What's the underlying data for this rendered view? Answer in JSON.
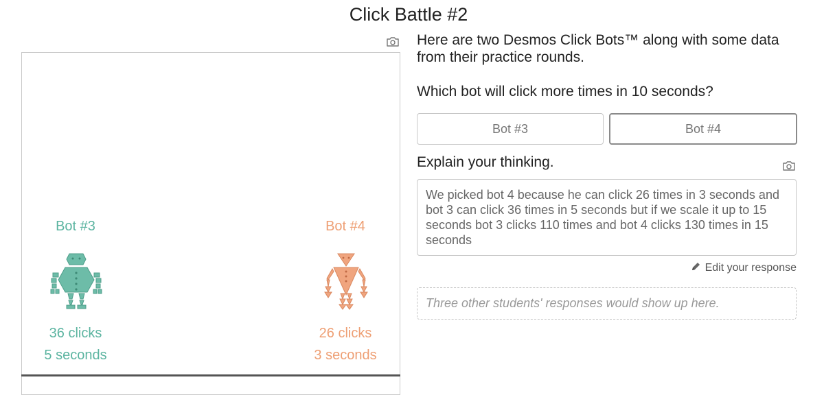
{
  "header": {
    "title": "Click Battle #2"
  },
  "icons": {
    "snapshot": "camera-icon",
    "edit": "pencil-icon"
  },
  "graph": {
    "bots": [
      {
        "name": "Bot #3",
        "clicks": "36 clicks",
        "time": "5 seconds",
        "color": "#5bb4a0"
      },
      {
        "name": "Bot #4",
        "clicks": "26 clicks",
        "time": "3 seconds",
        "color": "#ee9f74"
      }
    ]
  },
  "content": {
    "prompt": "Here are two Desmos Click Bots™ along with some data from their practice rounds.",
    "question": "Which bot will click more times in 10 seconds?",
    "choices": [
      {
        "label": "Bot #3",
        "selected": false
      },
      {
        "label": "Bot #4",
        "selected": true
      }
    ],
    "explain_label": "Explain your thinking.",
    "response_text": "We picked bot 4 because he can click 26 times in 3 seconds and bot 3 can click 36 times in 5 seconds but if we scale it up to 15 seconds bot 3 clicks 110 times and bot 4 clicks 130 times in 15 seconds",
    "edit_label": "Edit your response",
    "others_placeholder": "Three other students' responses would show up here."
  }
}
